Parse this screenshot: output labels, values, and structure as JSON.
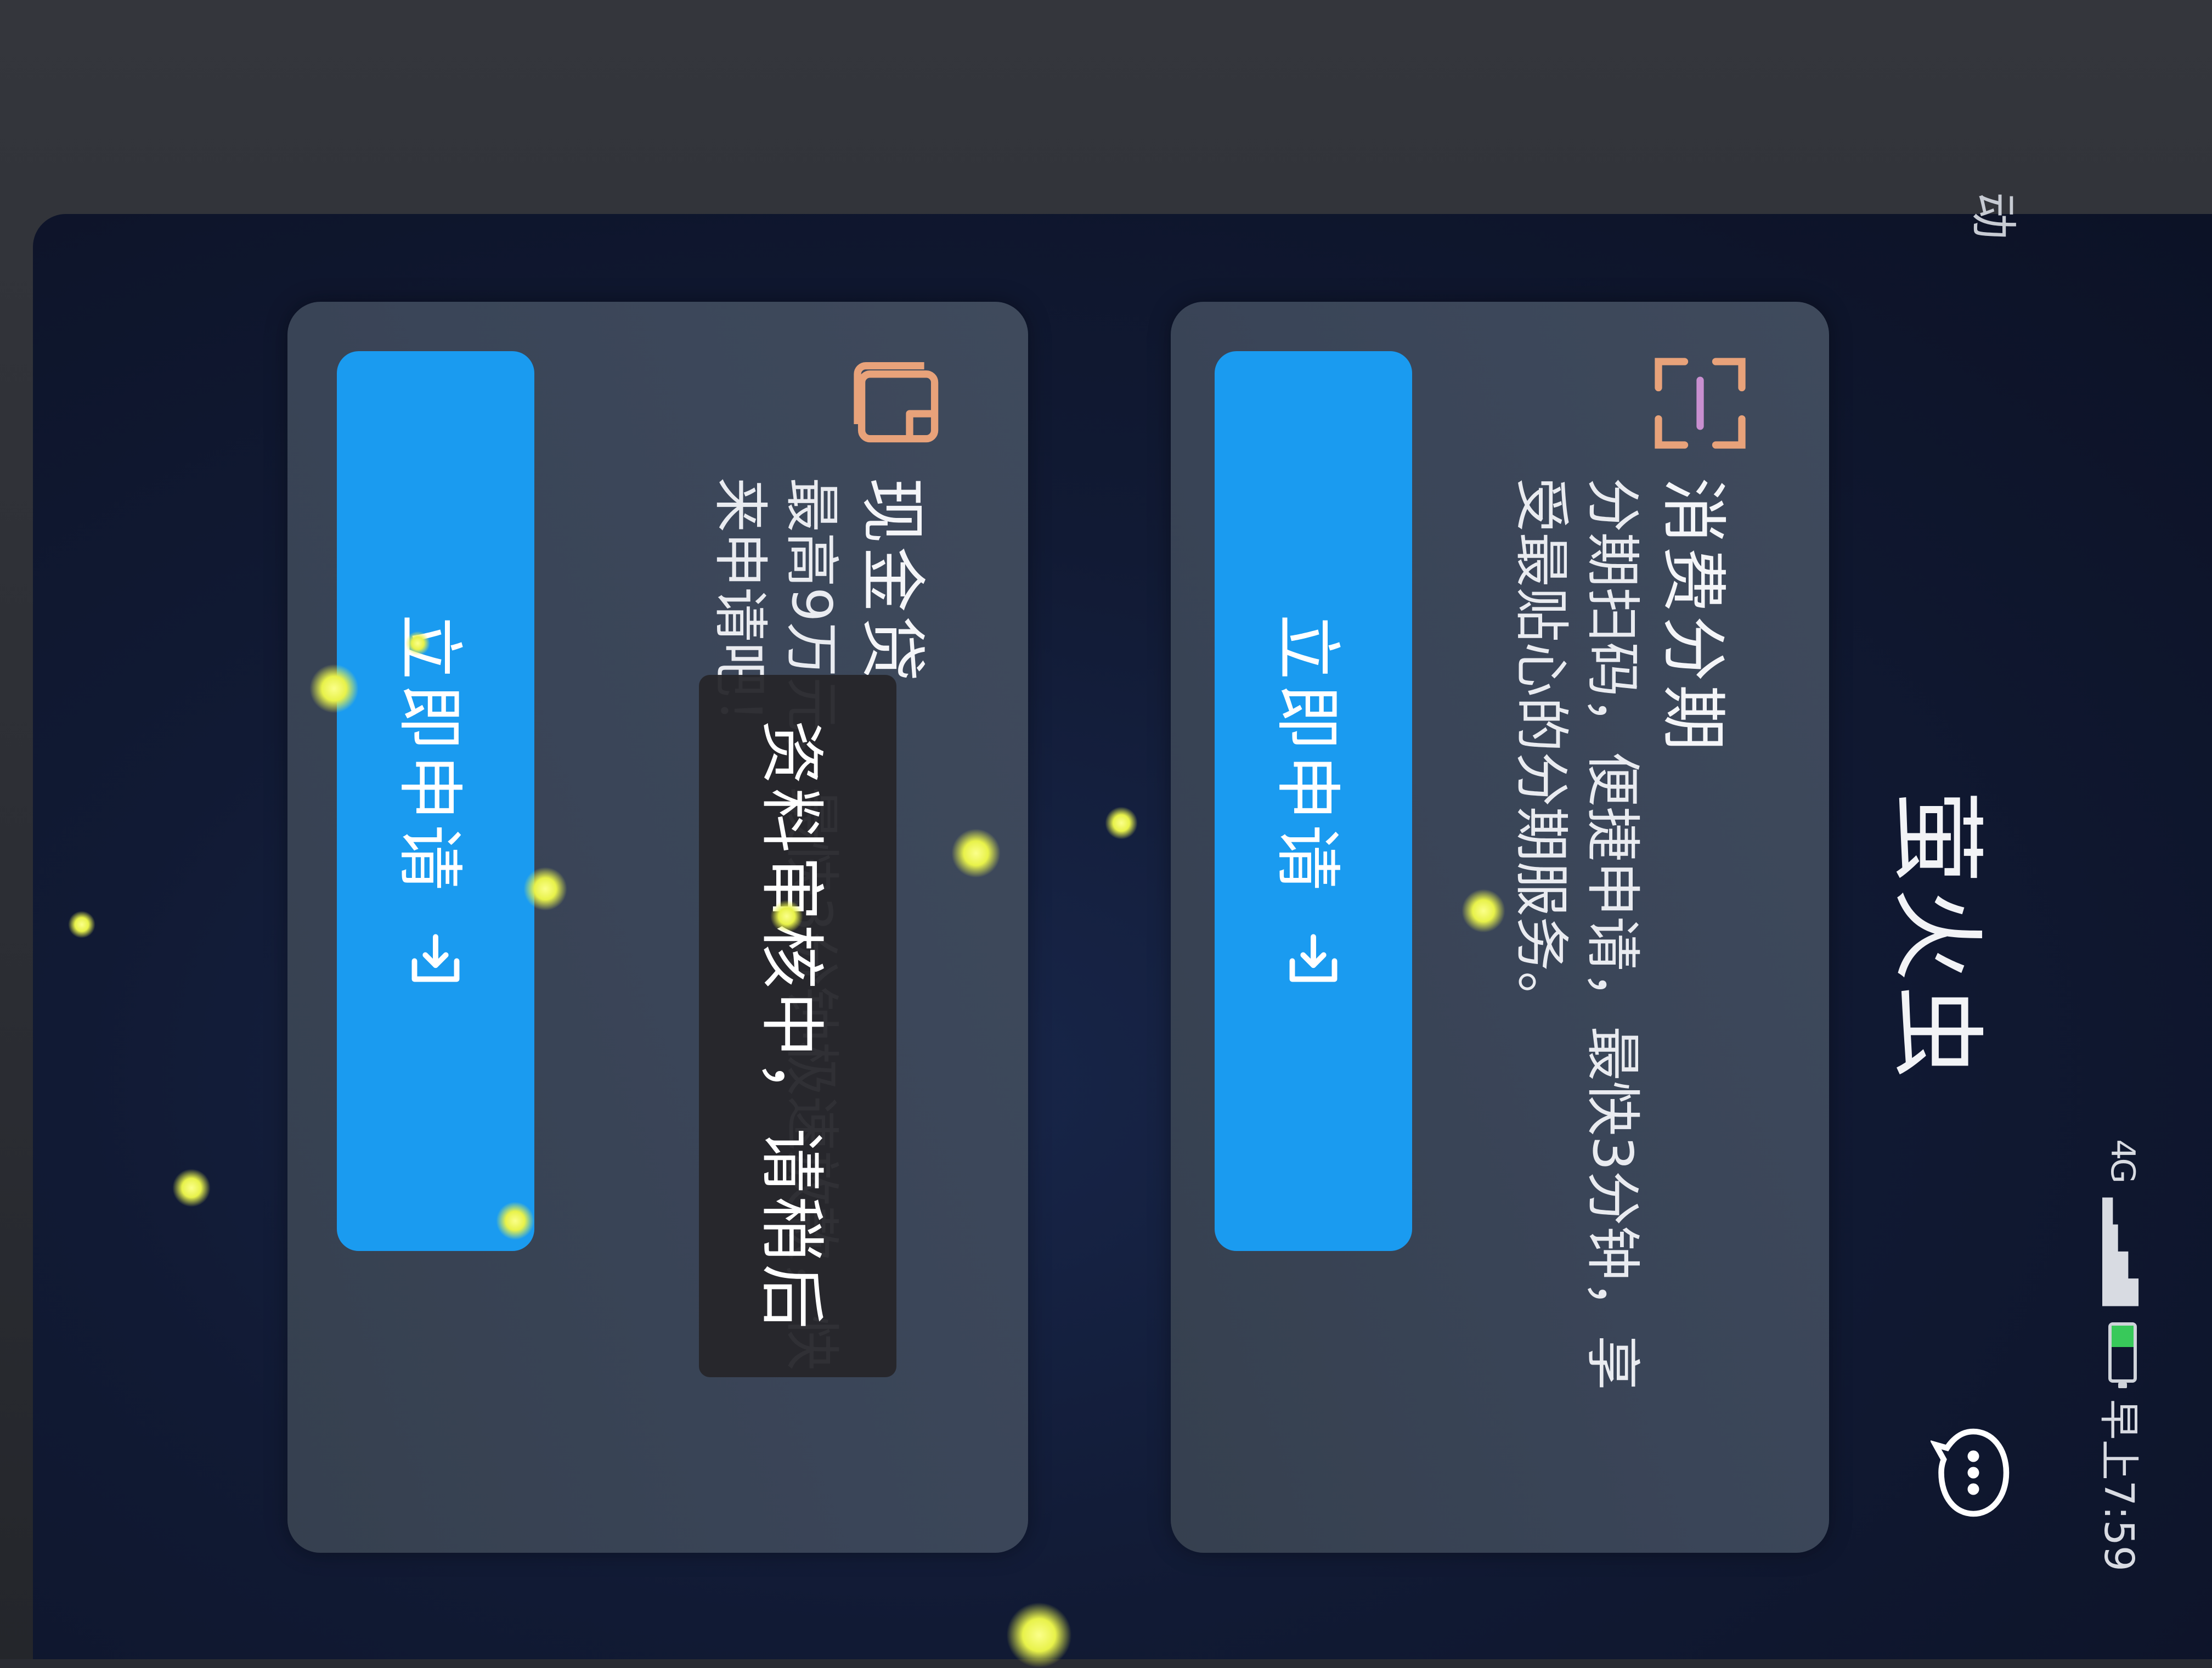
{
  "status_bar": {
    "network": "4G",
    "time": "早上7:59"
  },
  "nav": {
    "left_text": "动",
    "title": "萤火虫",
    "chat_icon": "chat-bubble-icon"
  },
  "cards": [
    {
      "icon": "scan-icon",
      "title": "消费分期",
      "description": "分期扫码，便捷申请，最快3分钟，享受最贴心的分期服务。",
      "button_label": "立即申请",
      "button_icon": "enter-arrow-icon"
    },
    {
      "icon": "wallet-icon",
      "title": "现金贷",
      "description": "最高9万元，最快3分钟极速放款，快来申请吧！",
      "button_label": "立即申请",
      "button_icon": "enter-arrow-icon"
    }
  ],
  "toast": {
    "text": "资料审核中，请稍后"
  },
  "colors": {
    "accent_button": "#1a9bf0",
    "card_bg": "#3b4657",
    "icon_accent": "#e8a27a",
    "firefly": "#e8f24a"
  }
}
